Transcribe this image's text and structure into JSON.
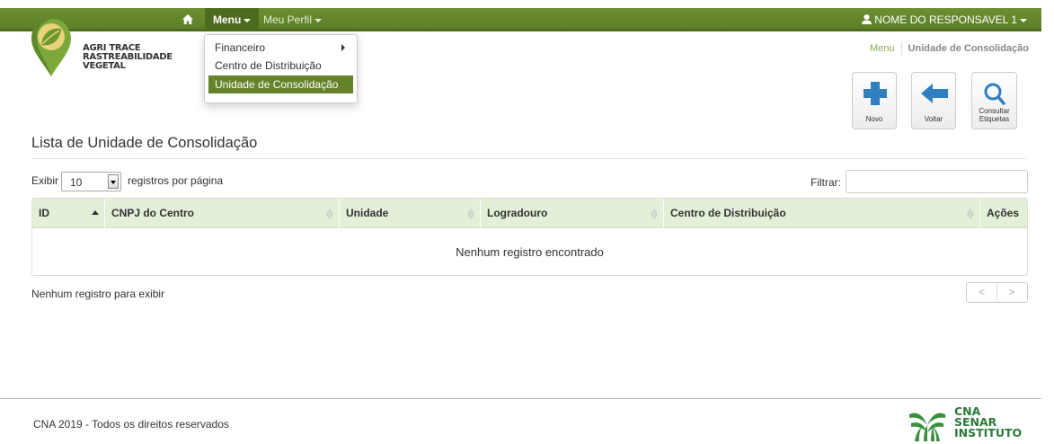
{
  "nav": {
    "home_icon": "home-icon",
    "menu_label": "Menu",
    "profile_label": "Meu Perfil",
    "user_icon": "user-icon",
    "user_label": "NOME DO RESPONSAVEL 1",
    "bar_color": "#64832b"
  },
  "brand": {
    "line1": "AGRI TRACE",
    "line2": "RASTREABILIDADE",
    "line3": "VEGETAL"
  },
  "dropdown": {
    "items": [
      {
        "label": "Financeiro",
        "has_submenu": true
      },
      {
        "label": "Centro de Distribuição"
      },
      {
        "label": "Unidade de Consolidação",
        "active": true
      }
    ]
  },
  "breadcrumb": {
    "link": "Menu",
    "current": "Unidade de Consolidação"
  },
  "actions": {
    "new_label": "Novo",
    "back_label": "Voltar",
    "consult_label_1": "Consultar",
    "consult_label_2": "Etiquetas"
  },
  "page": {
    "title": "Lista de Unidade de Consolidação"
  },
  "table_controls": {
    "show_label": "Exibir",
    "page_size": "10",
    "per_page_label": "registros por página",
    "filter_label": "Filtrar:",
    "filter_value": ""
  },
  "table": {
    "columns": [
      "ID",
      "CNPJ do Centro",
      "Unidade",
      "Logradouro",
      "Centro de Distribuição",
      "Ações"
    ],
    "empty_message": "Nenhum registro encontrado",
    "header_color": "#e2efd9"
  },
  "pagination": {
    "info": "Nenhum registro para exibir",
    "prev": "<",
    "next": ">"
  },
  "footer": {
    "copyright": "CNA 2019 - Todos os direitos reservados",
    "logo_line1": "CNA",
    "logo_line2": "SENAR",
    "logo_line3": "INSTITUTO"
  }
}
